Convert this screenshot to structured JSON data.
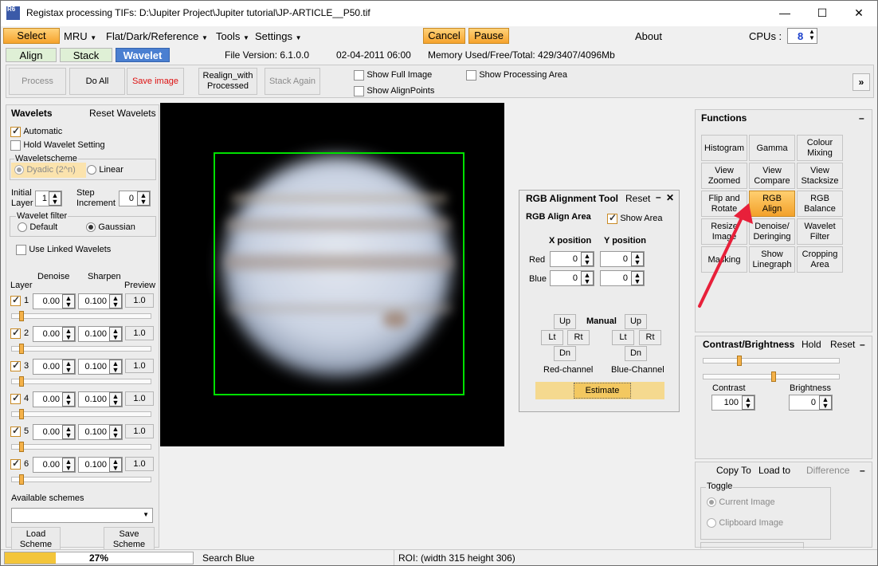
{
  "window": {
    "title": "Registax processing TIFs: D:\\Jupiter Project\\Jupiter tutorial\\JP-ARTICLE__P50.tif",
    "minimize": "—",
    "maximize": "☐",
    "close": "✕",
    "icon_text": "R6"
  },
  "menu": {
    "select": "Select",
    "mru": "MRU",
    "flat": "Flat/Dark/Reference",
    "tools": "Tools",
    "settings": "Settings",
    "cancel": "Cancel",
    "pause": "Pause",
    "about": "About",
    "cpus_label": "CPUs :",
    "cpus_value": "8"
  },
  "tabs": {
    "align": "Align",
    "stack": "Stack",
    "wavelet": "Wavelet"
  },
  "info": {
    "file_version": "File Version: 6.1.0.0",
    "date": "02-04-2011 06:00",
    "memory": "Memory Used/Free/Total: 429/3407/4096Mb"
  },
  "toolbar": {
    "process": "Process",
    "do_all": "Do All",
    "save_image": "Save image",
    "realign_line1": "Realign_with",
    "realign_line2": "Processed",
    "stack_again": "Stack Again",
    "show_full_image": "Show Full Image",
    "show_alignpoints": "Show AlignPoints",
    "show_processing_area": "Show Processing Area",
    "expand": "»"
  },
  "wavelets": {
    "title": "Wavelets",
    "reset": "Reset Wavelets",
    "automatic": "Automatic",
    "hold": "Hold Wavelet Setting",
    "scheme_label": "Waveletscheme",
    "dyadic": "Dyadic (2^n)",
    "linear": "Linear",
    "initial_layer_l1": "Initial",
    "initial_layer_l2": "Layer",
    "initial_layer_value": "1",
    "step_l1": "Step",
    "step_l2": "Increment",
    "step_value": "0",
    "filter_label": "Wavelet filter",
    "default": "Default",
    "gaussian": "Gaussian",
    "use_linked": "Use Linked Wavelets",
    "col_layer": "Layer",
    "col_denoise": "Denoise",
    "col_sharpen": "Sharpen",
    "col_preview": "Preview",
    "layers": [
      {
        "num": "1",
        "denoise": "0.00",
        "sharpen": "0.100",
        "preview": "1.0"
      },
      {
        "num": "2",
        "denoise": "0.00",
        "sharpen": "0.100",
        "preview": "1.0"
      },
      {
        "num": "3",
        "denoise": "0.00",
        "sharpen": "0.100",
        "preview": "1.0"
      },
      {
        "num": "4",
        "denoise": "0.00",
        "sharpen": "0.100",
        "preview": "1.0"
      },
      {
        "num": "5",
        "denoise": "0.00",
        "sharpen": "0.100",
        "preview": "1.0"
      },
      {
        "num": "6",
        "denoise": "0.00",
        "sharpen": "0.100",
        "preview": "1.0"
      }
    ],
    "available_schemes": "Available schemes",
    "load_l1": "Load",
    "load_l2": "Scheme",
    "save_l1": "Save",
    "save_l2": "Scheme"
  },
  "rgb_tool": {
    "title": "RGB Alignment Tool",
    "reset": "Reset",
    "area_label": "RGB Align Area",
    "show_area": "Show Area",
    "x_position": "X position",
    "y_position": "Y position",
    "red": "Red",
    "blue": "Blue",
    "red_x": "0",
    "red_y": "0",
    "blue_x": "0",
    "blue_y": "0",
    "up": "Up",
    "lt": "Lt",
    "rt": "Rt",
    "dn": "Dn",
    "manual": "Manual",
    "red_channel": "Red-channel",
    "blue_channel": "Blue-Channel",
    "estimate": "Estimate"
  },
  "functions": {
    "title": "Functions",
    "collapse": "–",
    "buttons": [
      [
        "Histogram"
      ],
      [
        "Gamma"
      ],
      [
        "Colour",
        "Mixing"
      ],
      [
        "View",
        "Zoomed"
      ],
      [
        "View",
        "Compare"
      ],
      [
        "View",
        "Stacksize"
      ],
      [
        "Flip and",
        "Rotate"
      ],
      [
        "RGB",
        "Align"
      ],
      [
        "RGB",
        "Balance"
      ],
      [
        "Resize",
        "Image"
      ],
      [
        "Denoise/",
        "Deringing"
      ],
      [
        "Wavelet",
        "Filter"
      ],
      [
        "Masking"
      ],
      [
        "Show",
        "Linegraph"
      ],
      [
        "Cropping",
        "Area"
      ]
    ]
  },
  "contrast": {
    "title": "Contrast/Brightness",
    "hold": "Hold",
    "reset": "Reset",
    "collapse": "–",
    "contrast_label": "Contrast",
    "contrast_value": "100",
    "brightness_label": "Brightness",
    "brightness_value": "0",
    "slider1_level": 0.25,
    "slider2_level": 0.5
  },
  "copy": {
    "copy_to": "Copy To",
    "load_to": "Load to",
    "difference": "Difference",
    "collapse": "–",
    "toggle": "Toggle",
    "current_image": "Current Image",
    "clipboard_image": "Clipboard Image"
  },
  "status": {
    "progress_text": "27%",
    "progress": 0.27,
    "message": "Search Blue",
    "roi": "ROI: (width 315 height 306)"
  },
  "colors": {
    "accent_orange": "#f6a32c",
    "active_tab": "#4a7fd1",
    "roi_green": "#00e000",
    "arrow_red": "#e8203a"
  }
}
